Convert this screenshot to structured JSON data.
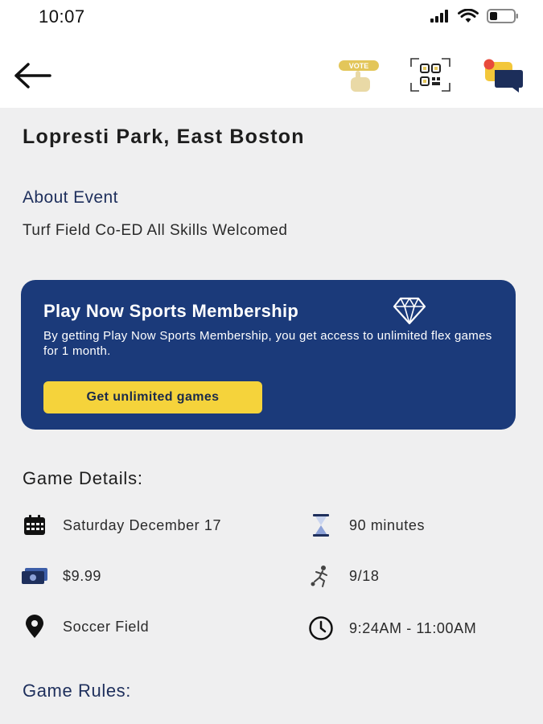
{
  "status_bar": {
    "time": "10:07"
  },
  "header": {
    "vote_label": "VOTE"
  },
  "venue": {
    "title": "Lopresti Park, East Boston"
  },
  "about": {
    "heading": "About Event",
    "text": "Turf Field Co-ED All Skills Welcomed"
  },
  "promo": {
    "title": "Play Now Sports Membership",
    "description": "By getting Play Now Sports Membership, you get access to unlimited flex games for 1 month.",
    "button_label": "Get unlimited games"
  },
  "game_details": {
    "heading": "Game Details:",
    "date": "Saturday December 17",
    "duration": "90 minutes",
    "price": "$9.99",
    "players": "9/18",
    "field": "Soccer Field",
    "time_range": "9:24AM - 11:00AM"
  },
  "game_rules": {
    "heading": "Game Rules:"
  },
  "colors": {
    "promo_bg": "#1b3a7a",
    "promo_button": "#f5d33b",
    "heading_blue": "#1e2f5c",
    "chat_bubble_yellow": "#f3c73a",
    "chat_dot_red": "#e84a3c"
  }
}
